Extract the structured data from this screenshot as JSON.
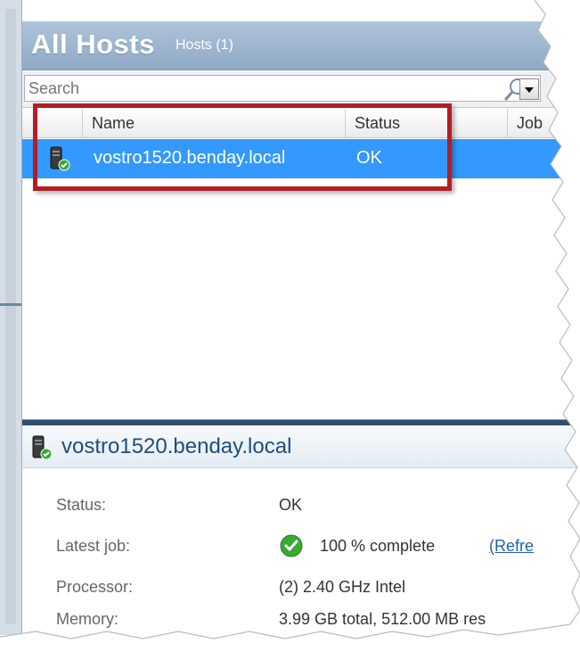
{
  "header": {
    "title": "All Hosts",
    "subtitle": "Hosts (1)"
  },
  "search": {
    "placeholder": "Search"
  },
  "columns": {
    "name": "Name",
    "status": "Status",
    "jobs": "Job"
  },
  "hosts": [
    {
      "name": "vostro1520.benday.local",
      "status": "OK"
    }
  ],
  "details": {
    "title": "vostro1520.benday.local",
    "fields": [
      {
        "label": "Status:",
        "value": "OK"
      },
      {
        "label": "Latest job:",
        "value": "100 % complete",
        "link": "(Refre"
      },
      {
        "label": "Processor:",
        "value": "(2) 2.40 GHz  Intel"
      },
      {
        "label": "Memory:",
        "value": "3.99 GB total,  512.00 MB res"
      }
    ]
  },
  "colors": {
    "header": "#9db5d1",
    "selected_row": "#3399ff",
    "highlight_box": "#b21e26",
    "link": "#1e62b0",
    "ok_icon": "#39a935"
  },
  "icons": {
    "host": "server-ok-icon",
    "search": "search-icon",
    "job_status": "check-circle-icon"
  }
}
